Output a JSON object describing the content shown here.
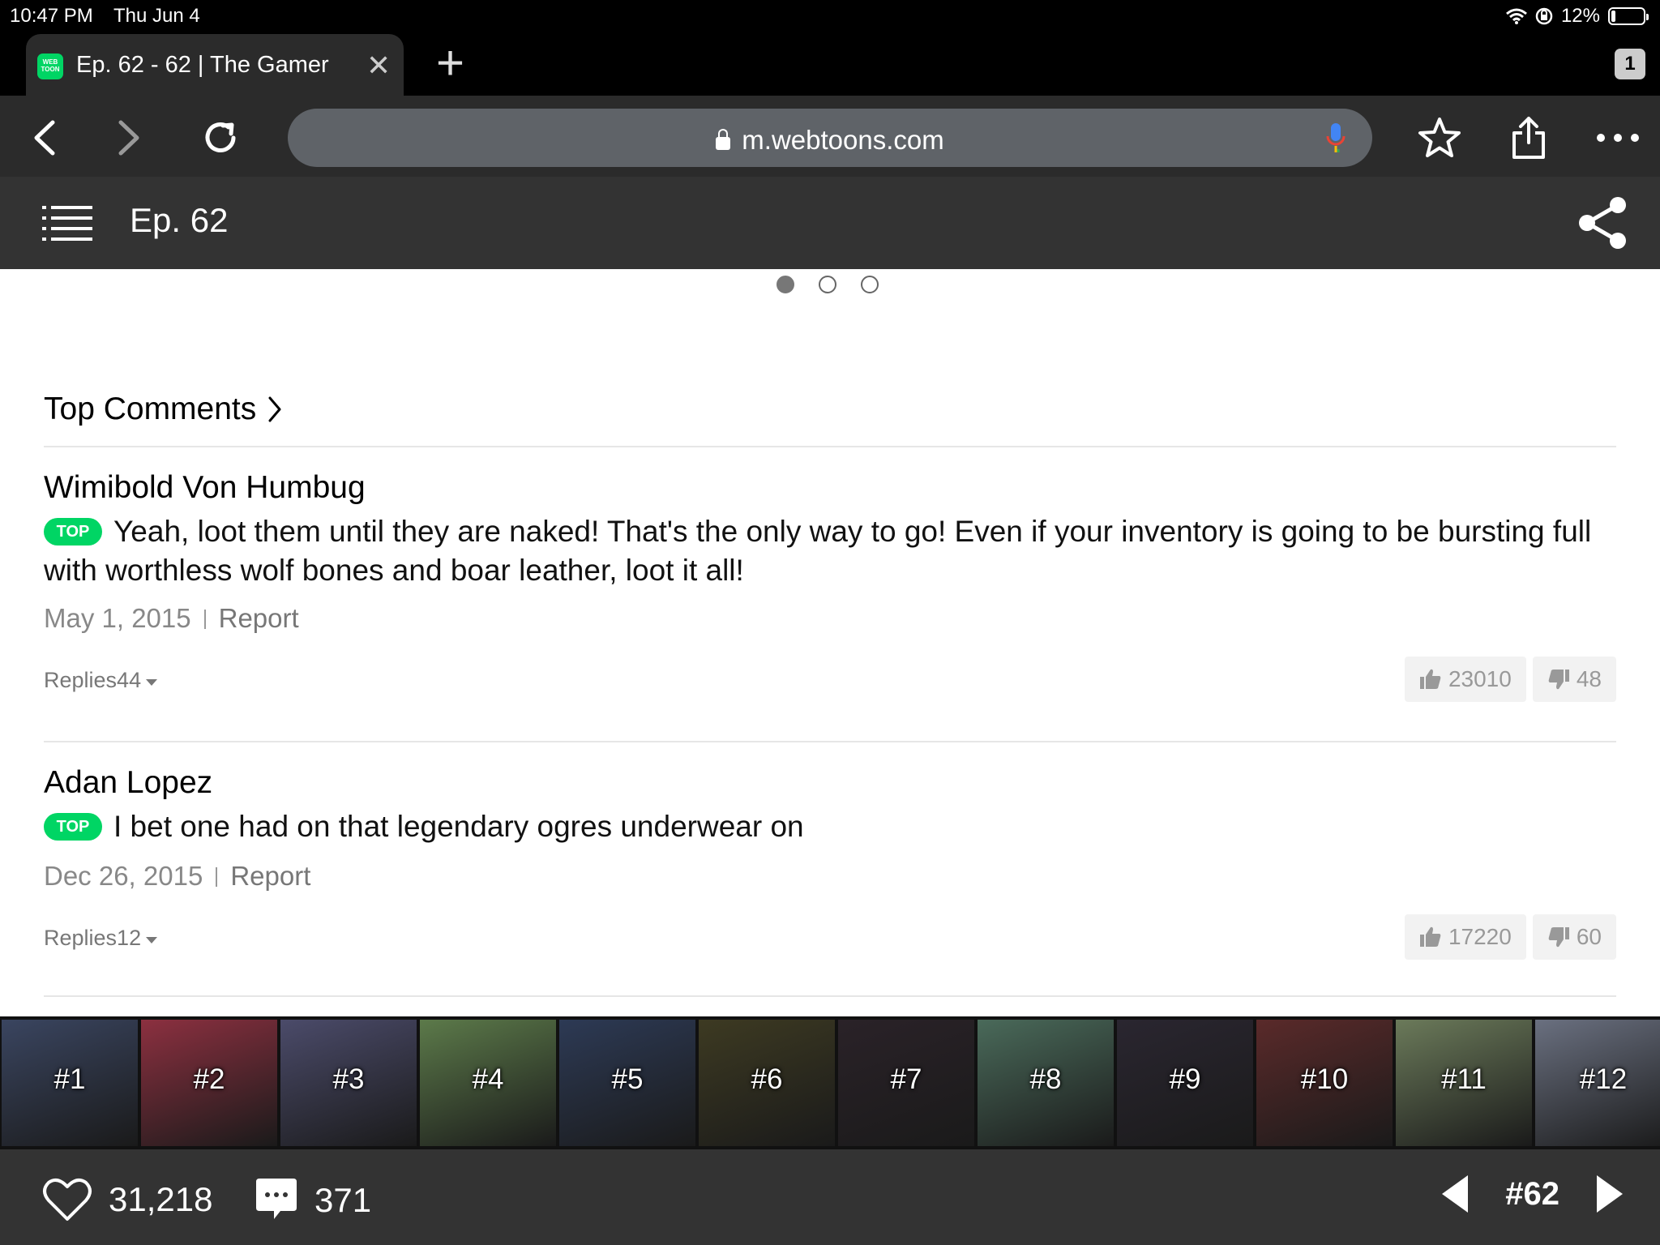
{
  "status": {
    "time": "10:47 PM",
    "date": "Thu Jun 4",
    "battery_text": "12%",
    "battery_level": 0.12
  },
  "tabs": {
    "active_title": "Ep. 62 - 62 | The Gamer",
    "favicon_text": "WEB TOON",
    "count": "1"
  },
  "toolbar": {
    "url": "m.webtoons.com"
  },
  "episode": {
    "title": "Ep. 62",
    "carousel_count": 3,
    "carousel_active": 0
  },
  "comments": {
    "heading": "Top Comments",
    "badge": "TOP",
    "report_label": "Report",
    "replies_label": "Replies",
    "items": [
      {
        "author": "Wimibold Von Humbug",
        "text": "Yeah, loot them until they are naked! That's the only way to go! Even if your inventory is going to be bursting full with worthless wolf bones and boar leather, loot it all!",
        "date": "May 1, 2015",
        "replies": "44",
        "likes": "23010",
        "dislikes": "48"
      },
      {
        "author": "Adan Lopez",
        "text": "I bet one had on that legendary ogres underwear on",
        "date": "Dec 26, 2015",
        "replies": "12",
        "likes": "17220",
        "dislikes": "60"
      }
    ]
  },
  "episode_strip": [
    {
      "label": "#1",
      "color": "#3a4560"
    },
    {
      "label": "#2",
      "color": "#8c3040"
    },
    {
      "label": "#3",
      "color": "#4b4b6a"
    },
    {
      "label": "#4",
      "color": "#5c7a4a"
    },
    {
      "label": "#5",
      "color": "#2d3a55"
    },
    {
      "label": "#6",
      "color": "#3d3a22"
    },
    {
      "label": "#7",
      "color": "#2a2228"
    },
    {
      "label": "#8",
      "color": "#4a6a5a"
    },
    {
      "label": "#9",
      "color": "#2a2630"
    },
    {
      "label": "#10",
      "color": "#5a2a2a"
    },
    {
      "label": "#11",
      "color": "#6b7a5a"
    },
    {
      "label": "#12",
      "color": "#6a7080"
    }
  ],
  "bottom_bar": {
    "likes": "31,218",
    "comments": "371",
    "current_episode": "#62"
  },
  "colors": {
    "brand_green": "#00d564",
    "header_bg": "#333333",
    "toolbar_bg": "#2b2b2b"
  }
}
